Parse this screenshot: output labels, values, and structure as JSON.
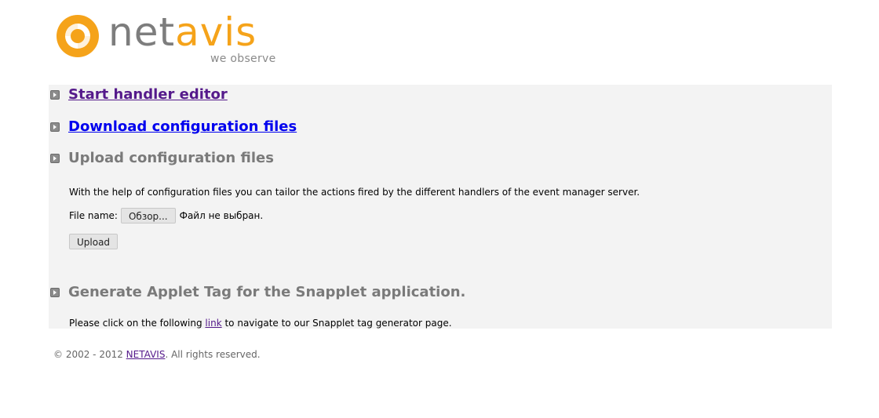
{
  "logo": {
    "name_part1": "net",
    "name_part2": "avis",
    "tagline": "we observe",
    "brand_orange": "#f5a31a",
    "brand_gray": "#7d7d7d"
  },
  "sections": {
    "handler_editor": {
      "label": "Start handler editor",
      "icon": "arrow-bullet-icon"
    },
    "download": {
      "label": "Download configuration files",
      "icon": "arrow-bullet-icon"
    },
    "upload": {
      "label": "Upload configuration files",
      "icon": "arrow-bullet-icon",
      "description": "With the help of configuration files you can tailor the actions fired by the different handlers of the event manager server.",
      "file_label": "File name:",
      "browse_label": "Обзор...",
      "file_status": "Файл не выбран.",
      "upload_button": "Upload"
    },
    "applet": {
      "label": "Generate Applet Tag for the Snapplet application.",
      "icon": "arrow-bullet-icon",
      "text_before": "Please click on the following ",
      "link_label": "link",
      "text_after": " to navigate to our Snapplet tag generator page."
    }
  },
  "footer": {
    "copyright": "© 2002 - 2012 ",
    "company_link": "NETAVIS",
    "rights": ". All rights reserved."
  }
}
